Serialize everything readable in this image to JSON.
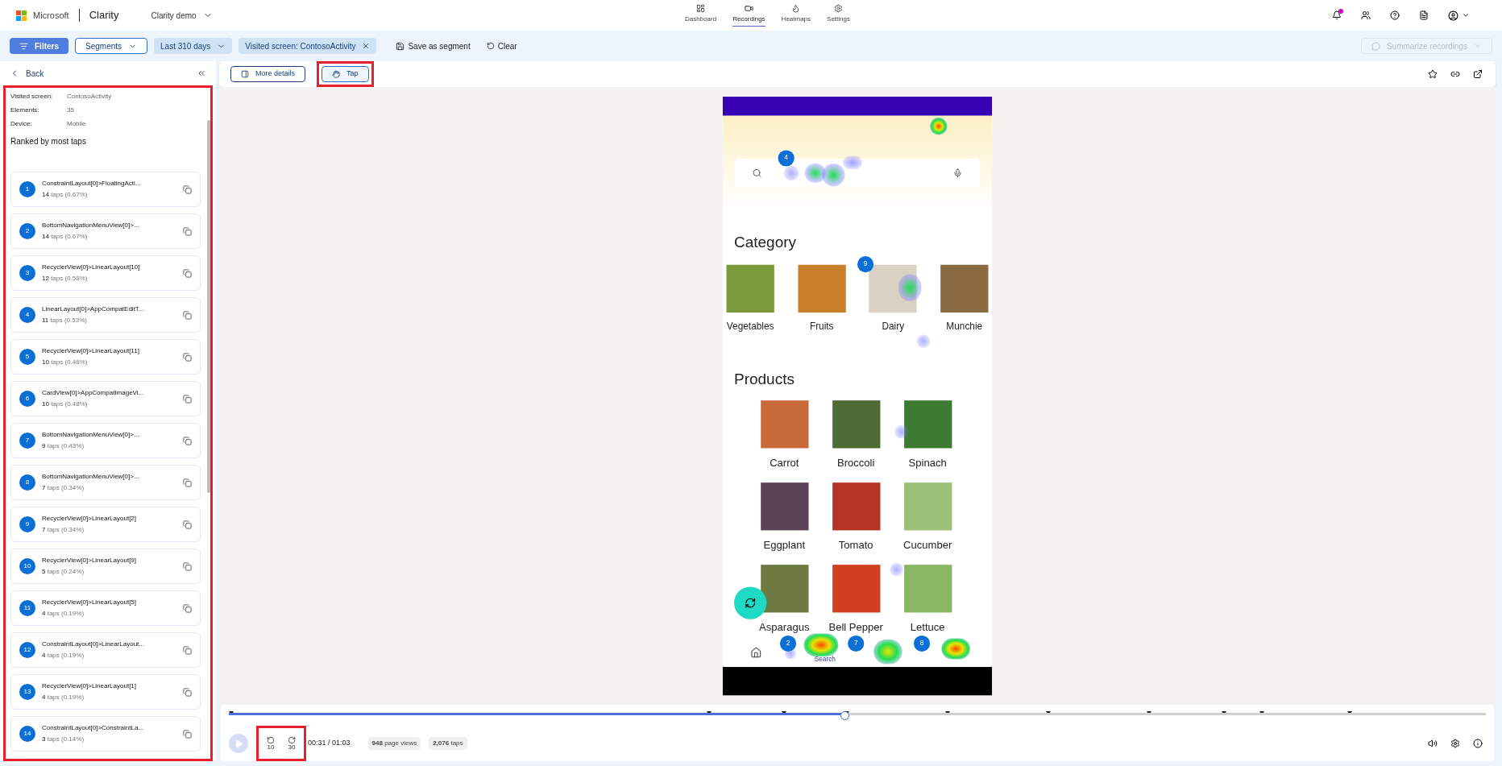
{
  "header": {
    "brand": "Microsoft",
    "product": "Clarity",
    "project": "Clarity demo",
    "notification_unread": true,
    "nav": [
      {
        "label": "Dashboard",
        "selected": false
      },
      {
        "label": "Recordings",
        "selected": true
      },
      {
        "label": "Heatmaps",
        "selected": false
      },
      {
        "label": "Settings",
        "selected": false
      }
    ]
  },
  "filter_bar": {
    "filters": "Filters",
    "segments": "Segments",
    "date": "Last 310 days",
    "chip": "Visited screen: ContosoActivity",
    "save": "Save as segment",
    "clear": "Clear",
    "summarize": {
      "label": "Summarize recordings",
      "disabled": true
    }
  },
  "side_panel": {
    "back": "Back",
    "highlighted": true,
    "details": [
      {
        "label": "Visited screen:",
        "value": "ContosoActivity"
      },
      {
        "label": "Elements:",
        "value": "35"
      },
      {
        "label": "Device:",
        "value": "Mobile"
      }
    ],
    "heading": "Ranked by most taps",
    "items": [
      {
        "rank": "1",
        "name": "ConstraintLayout[0]>FloatingActi...",
        "count": "14",
        "detail": "taps (0.67%)"
      },
      {
        "rank": "2",
        "name": "BottomNavigationMenuView[0]>...",
        "count": "14",
        "detail": "taps (0.67%)"
      },
      {
        "rank": "3",
        "name": "RecyclerView[0]>LinearLayout[10]",
        "count": "12",
        "detail": "taps (0.58%)"
      },
      {
        "rank": "4",
        "name": "LinearLayout[0]>AppCompatEditT...",
        "count": "11",
        "detail": "taps (0.53%)"
      },
      {
        "rank": "5",
        "name": "RecyclerView[0]>LinearLayout[11]",
        "count": "10",
        "detail": "taps (0.48%)"
      },
      {
        "rank": "6",
        "name": "CardView[0]>AppCompatImageVi...",
        "count": "10",
        "detail": "taps (0.48%)"
      },
      {
        "rank": "7",
        "name": "BottomNavigationMenuView[0]>...",
        "count": "9",
        "detail": "taps (0.43%)"
      },
      {
        "rank": "8",
        "name": "BottomNavigationMenuView[0]>...",
        "count": "7",
        "detail": "taps (0.34%)"
      },
      {
        "rank": "9",
        "name": "RecyclerView[0]>LinearLayout[2]",
        "count": "7",
        "detail": "taps (0.34%)"
      },
      {
        "rank": "10",
        "name": "RecyclerView[0]>LinearLayout[9]",
        "count": "5",
        "detail": "taps (0.24%)"
      },
      {
        "rank": "11",
        "name": "RecyclerView[0]>LinearLayout[5]",
        "count": "4",
        "detail": "taps (0.19%)"
      },
      {
        "rank": "12",
        "name": "ConstraintLayout[0]>LinearLayout...",
        "count": "4",
        "detail": "taps (0.19%)"
      },
      {
        "rank": "13",
        "name": "RecyclerView[0]>LinearLayout[1]",
        "count": "4",
        "detail": "taps (0.19%)"
      },
      {
        "rank": "14",
        "name": "ConstraintLayout[0]>ConstraintLa...",
        "count": "3",
        "detail": "taps (0.14%)"
      }
    ]
  },
  "toolbar": {
    "tabs": [
      {
        "label": "More details",
        "selected": false,
        "highlighted": false
      },
      {
        "label": "Tap",
        "selected": true,
        "highlighted": true
      }
    ]
  },
  "phone": {
    "category_title": "Category",
    "categories": [
      "Vegetables",
      "Fruits",
      "Dairy",
      "Munchie"
    ],
    "products_title": "Products",
    "products": [
      "Carrot",
      "Broccoli",
      "Spinach",
      "Eggplant",
      "Tomato",
      "Cucumber",
      "Asparagus",
      "Bell Pepper",
      "Lettuce"
    ],
    "nav_label": "Search",
    "markers": [
      "4",
      "9",
      "2",
      "7",
      "8"
    ]
  },
  "player": {
    "time": "00:31 / 01:03",
    "level": 0.49,
    "skip": [
      "10",
      "30"
    ],
    "skip_highlighted": true,
    "page_views": {
      "count": "948",
      "label": "page views"
    },
    "taps": {
      "count": "2,076",
      "label": "taps"
    }
  }
}
